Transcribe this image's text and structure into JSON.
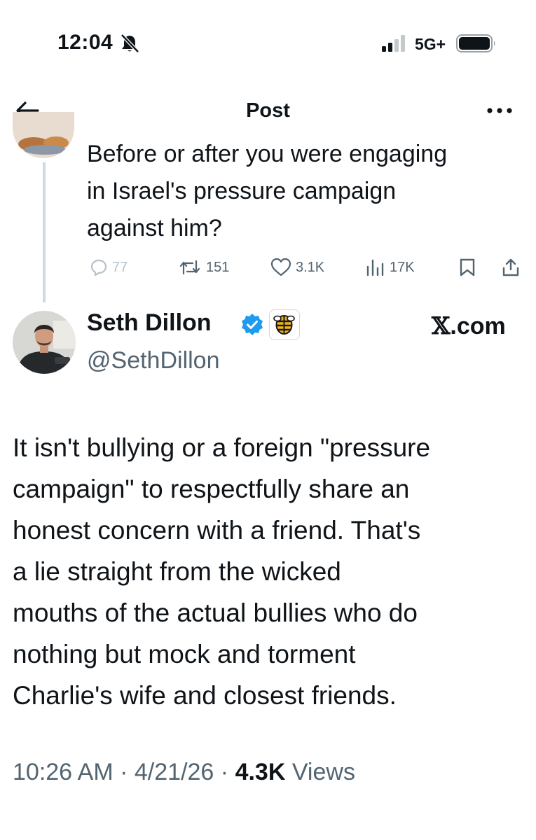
{
  "status_bar": {
    "time": "12:04",
    "network": "5G+",
    "icons": [
      "bell-slash-icon",
      "signal-icon",
      "battery-icon"
    ]
  },
  "nav": {
    "title": "Post",
    "icons": [
      "back-arrow-icon",
      "more-icon"
    ]
  },
  "previous_tweet": {
    "text_lines": [
      "Before or after you were engaging",
      "in Israel's pressure campaign",
      "against him?"
    ],
    "stats": {
      "replies": "77",
      "retweets": "151",
      "likes": "3.1K",
      "views": "17K"
    },
    "icons": [
      "reply-icon",
      "retweet-icon",
      "like-icon",
      "views-icon",
      "bookmark-icon",
      "share-icon"
    ]
  },
  "tweet": {
    "display_name": "Seth Dillon",
    "handle": "@SethDillon",
    "source": ".com",
    "source_glyph": "𝕏",
    "body_lines": [
      "It isn't bullying or a foreign \"pressure",
      "campaign\" to respectfully share an",
      "honest concern with a friend. That's",
      "a lie straight from the wicked",
      "mouths of the actual bullies who do",
      "nothing but mock and torment",
      "Charlie's wife and closest friends."
    ],
    "time": "10:26 AM",
    "date": "4/21/26",
    "views_count": "4.3K",
    "views_label": "Views",
    "separator": "·",
    "colors": {
      "verified": "#1d9bf0",
      "muted": "#536471",
      "text": "#0f1419"
    }
  }
}
